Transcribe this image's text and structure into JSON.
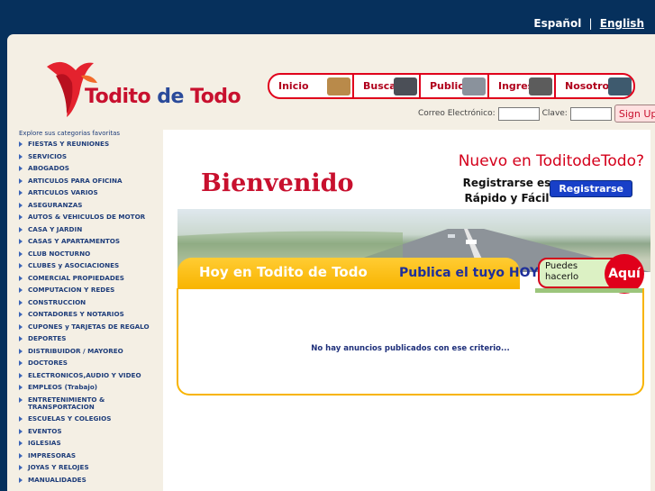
{
  "lang": {
    "spanish": "Español",
    "sep": "|",
    "english": "English"
  },
  "logo": {
    "word1": "Todito ",
    "word2": "de ",
    "word3": "Todo"
  },
  "nav": [
    {
      "label": "Inicio",
      "icon": "home-icon",
      "color": "#b98a4a"
    },
    {
      "label": "Buscar",
      "icon": "binoculars-icon",
      "color": "#4b4f57"
    },
    {
      "label": "Publicar",
      "icon": "car-icon",
      "color": "#8a929c"
    },
    {
      "label": "Ingreso",
      "icon": "laptop-icon",
      "color": "#5c5c5c"
    },
    {
      "label": "Nosotros",
      "icon": "people-icon",
      "color": "#3e5a6e"
    }
  ],
  "login": {
    "email_label": "Correo Electrónico:",
    "email_value": "",
    "password_label": "Clave:",
    "password_value": "",
    "submit": "Sign Up"
  },
  "sidebar": {
    "header": "Explore sus categorias favoritas",
    "categories": [
      "FIESTAS Y REUNIONES",
      "SERVICIOS",
      "ABOGADOS",
      "ARTICULOS PARA OFICINA",
      "ARTICULOS VARIOS",
      "ASEGURANZAS",
      "AUTOS & VEHICULOS DE MOTOR",
      "CASA Y JARDIN",
      "CASAS Y APARTAMENTOS",
      "CLUB NOCTURNO",
      "CLUBES y ASOCIACIONES",
      "COMERCIAL PROPIEDADES",
      "COMPUTACION Y REDES",
      "CONSTRUCCION",
      "CONTADORES Y NOTARIOS",
      "CUPONES y TARJETAS DE REGALO",
      "DEPORTES",
      "DISTRIBUIDOR / MAYOREO",
      "DOCTORES",
      "ELECTRONICOS,AUDIO Y VIDEO",
      "EMPLEOS (Trabajo)",
      "ENTRETENIMIENTO & TRANSPORTACION",
      "ESCUELAS Y COLEGIOS",
      "EVENTOS",
      "IGLESIAS",
      "IMPRESORAS",
      "JOYAS Y RELOJES",
      "MANUALIDADES"
    ]
  },
  "welcome": {
    "new_prompt": "Nuevo en ToditodeTodo?",
    "title": "Bienvenido",
    "register_line1": "Registrarse es",
    "register_line2": "Rápido y Fácil",
    "register_button": "Registrarse"
  },
  "banner": {
    "today": "Hoy en  Todito de Todo",
    "publish": "Publica el tuyo HOY",
    "can_line1": "Puedes",
    "can_line2": "hacerlo",
    "here": "Aquí"
  },
  "listing": {
    "empty_message": "No hay anuncios publicados con ese criterio..."
  }
}
